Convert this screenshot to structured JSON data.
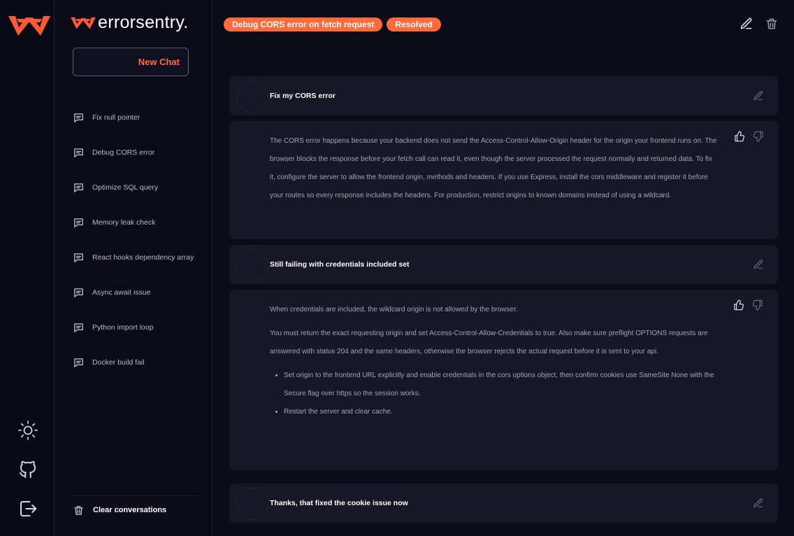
{
  "app": {
    "brand_name": "errorsentry."
  },
  "sidebar": {
    "new_chat_label": "New Chat",
    "history": [
      {
        "label": "Fix null pointer"
      },
      {
        "label": "Debug CORS error"
      },
      {
        "label": "Optimize SQL query"
      },
      {
        "label": "Memory leak check"
      },
      {
        "label": "React hooks dependency array"
      },
      {
        "label": "Async await issue"
      },
      {
        "label": "Python import loop"
      },
      {
        "label": "Docker build fail"
      }
    ],
    "clear_label": "Clear conversations"
  },
  "header": {
    "title": "Debug CORS error on fetch request",
    "badge": "Resolved"
  },
  "messages": [
    {
      "role": "user",
      "text": "Fix my CORS error"
    },
    {
      "role": "assistant",
      "paragraphs": [
        "The CORS error happens because your backend does not send the Access-Control-Allow-Origin header for the origin your frontend runs on. The browser blocks the response before your fetch call can read it, even though the server processed the request normally and returned data. To fix it, configure the server to allow the frontend origin, methods and headers. If you use Express, install the cors middleware and register it before your routes so every response includes the headers. For production, restrict origins to known domains instead of using a wildcard."
      ]
    },
    {
      "role": "user",
      "text": "Still failing with credentials included set"
    },
    {
      "role": "assistant",
      "paragraphs": [
        "When credentials are included, the wildcard origin is not allowed by the browser.",
        "You must return the exact requesting origin and set Access-Control-Allow-Credentials to true. Also make sure preflight OPTIONS requests are answered with status 204 and the same headers, otherwise the browser rejects the actual request before it is sent to your api."
      ],
      "bullets": [
        "Set origin to the frontend URL explicitly and enable credentials in the cors options object, then confirm cookies use SameSite None with the Secure flag over https so the session works.",
        "Restart the server and clear cache."
      ]
    },
    {
      "role": "user",
      "text": "Thanks, that fixed the cookie issue now"
    }
  ]
}
